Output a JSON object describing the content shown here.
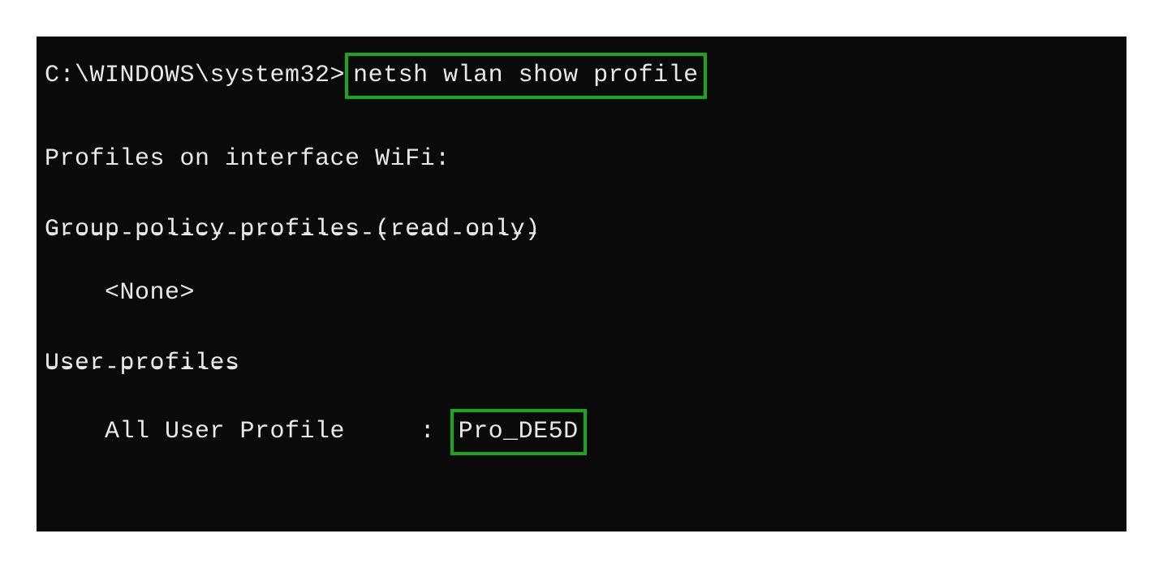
{
  "terminal": {
    "prompt": "C:\\WINDOWS\\system32>",
    "command": "netsh wlan show profile",
    "output": {
      "header": "Profiles on interface WiFi:",
      "group_policy_label": "Group policy profiles (read only)",
      "group_policy_dashes": "---------------------------------",
      "group_policy_value": "    <None>",
      "user_profiles_label": "User profiles",
      "user_profiles_dashes": "-------------",
      "all_user_profile_label": "    All User Profile     : ",
      "all_user_profile_value": "Pro_DE5D"
    }
  }
}
